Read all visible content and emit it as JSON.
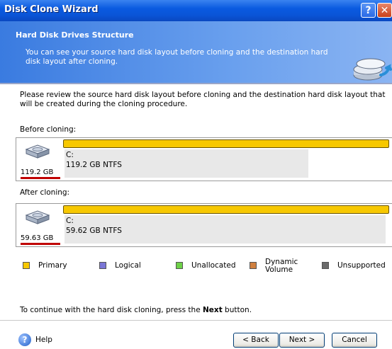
{
  "window": {
    "title": "Disk Clone Wizard",
    "help_glyph": "?",
    "close_glyph": "✕"
  },
  "header": {
    "title": "Hard Disk Drives Structure",
    "description": "You can see your source hard disk layout before cloning and the destination hard disk layout after cloning."
  },
  "intro": "Please review the source hard disk layout before cloning and the destination hard disk layout that will be created during the cloning procedure.",
  "before": {
    "label": "Before cloning:",
    "disk_size": "119.2 GB",
    "partition_letter": "C:",
    "partition_info": "119.2 GB  NTFS",
    "used_fraction": 0.75
  },
  "after": {
    "label": "After cloning:",
    "disk_size": "59.63 GB",
    "partition_letter": "C:",
    "partition_info": "59.62 GB  NTFS",
    "used_fraction": 0.99
  },
  "legend": [
    {
      "label": "Primary",
      "color": "#f7c800"
    },
    {
      "label": "Logical",
      "color": "#7a76d6"
    },
    {
      "label": "Unallocated",
      "color": "#6ed148"
    },
    {
      "label": "Dynamic Volume",
      "color": "#d08040"
    },
    {
      "label": "Unsupported",
      "color": "#6b6b6b"
    }
  ],
  "footer": {
    "text_before": "To continue with the hard disk cloning, press the ",
    "text_bold": "Next",
    "text_after": " button."
  },
  "buttons": {
    "help": "Help",
    "back": "< Back",
    "next": "Next >",
    "cancel": "Cancel"
  }
}
